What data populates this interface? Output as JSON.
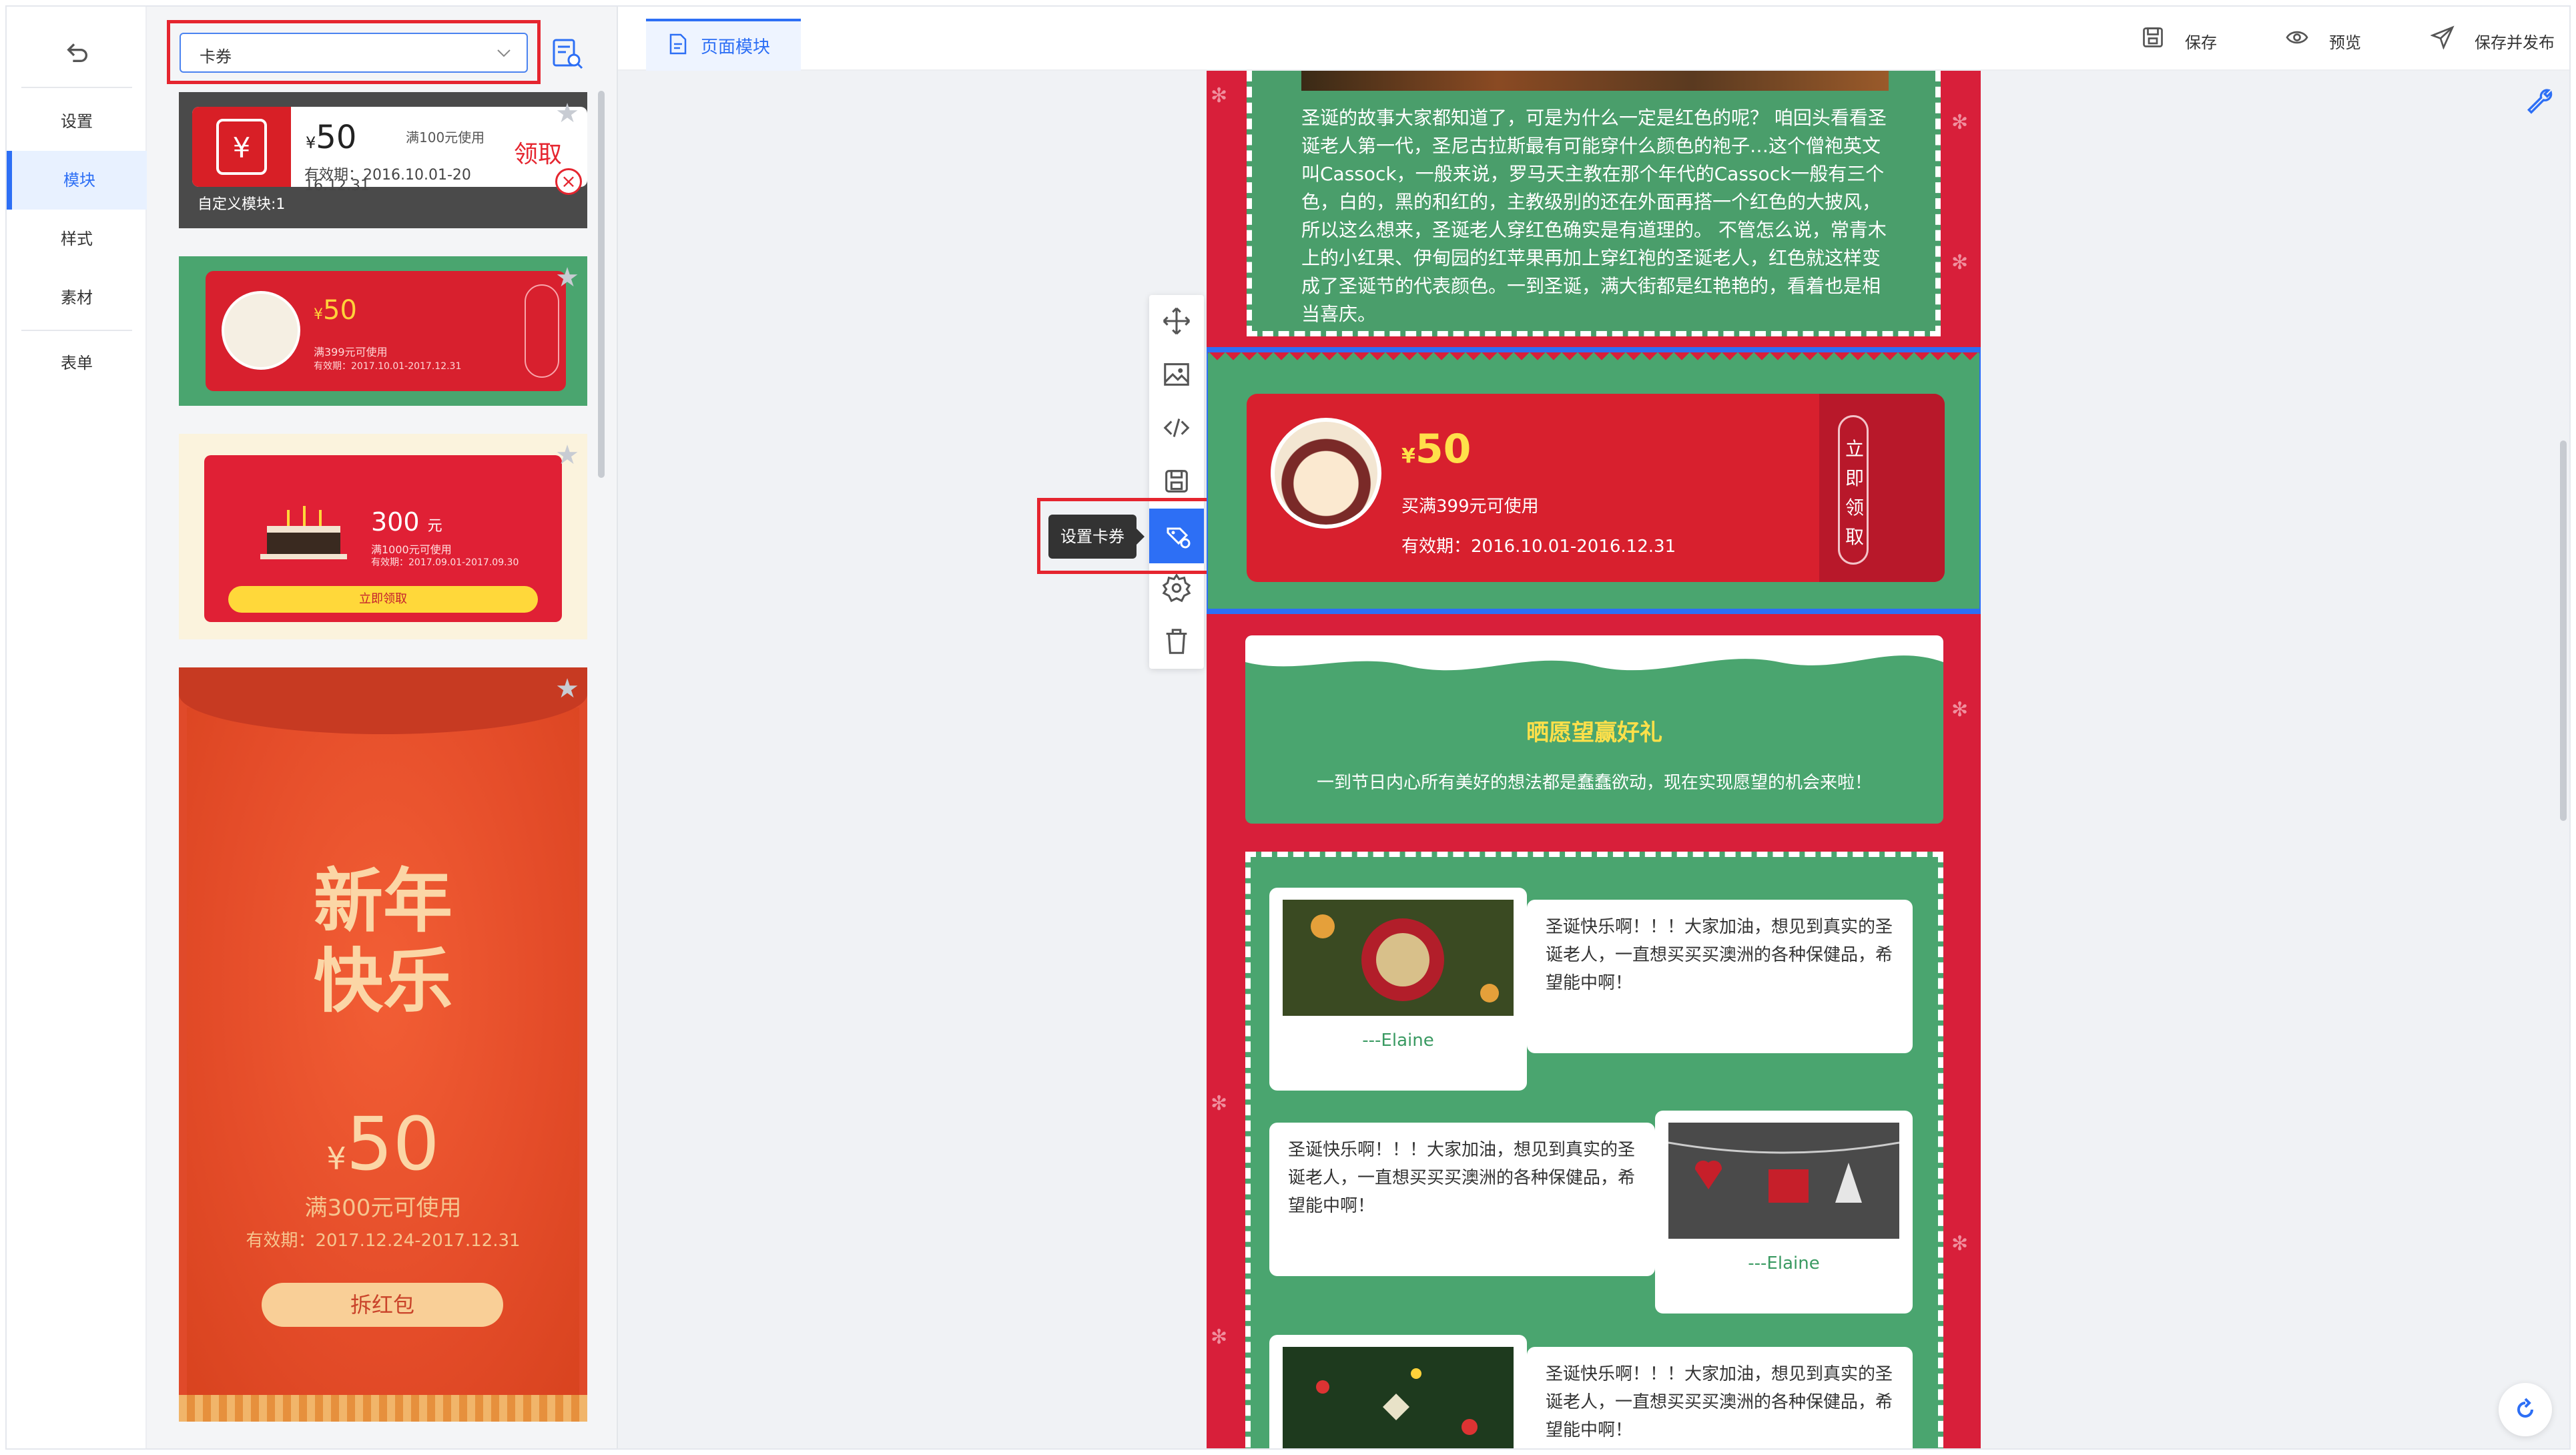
{
  "nav": {
    "items": [
      {
        "label": "设置",
        "active": false
      },
      {
        "label": "模块",
        "active": true
      },
      {
        "label": "样式",
        "active": false
      },
      {
        "label": "素材",
        "active": false
      },
      {
        "label": "表单",
        "active": false
      }
    ]
  },
  "panel": {
    "category_select": {
      "value": "卡券"
    },
    "templates": {
      "t1": {
        "amount": "50",
        "currency": "¥",
        "min": "满100元使用",
        "valid_line1": "有效期：2016.10.01-20",
        "valid_line2": "16.12.31",
        "get": "领取",
        "label": "自定义模块:1"
      },
      "t2": {
        "amount": "50",
        "currency": "¥",
        "min": "满399元可使用",
        "valid": "有效期：2017.10.01-2017.12.31"
      },
      "t3": {
        "amount": "300",
        "unit": "元",
        "min": "满1000元可使用",
        "valid": "有效期：2017.09.01-2017.09.30",
        "button": "立即领取"
      },
      "t4": {
        "title_line1": "新年",
        "title_line2": "快乐",
        "amount": "50",
        "currency": "¥",
        "min": "满300元可使用",
        "valid": "有效期：2017.12.24-2017.12.31",
        "button": "拆红包"
      }
    }
  },
  "topbar": {
    "tab_label": "页面模块",
    "save": "保存",
    "preview": "预览",
    "save_publish": "保存并发布"
  },
  "canvas": {
    "story_text": "圣诞的故事大家都知道了，可是为什么一定是红色的呢？ 咱回头看看圣诞老人第一代，圣尼古拉斯最有可能穿什么颜色的袍子…这个僧袍英文叫Cassock，一般来说，罗马天主教在那个年代的Cassock一般有三个色，白的，黑的和红的，主教级别的还在外面再搭一个红色的大披风，所以这么想来，圣诞老人穿红色确实是有道理的。 不管怎么说，常青木上的小红果、伊甸园的红苹果再加上穿红袍的圣诞老人，红色就这样变成了圣诞节的代表颜色。一到圣诞，满大街都是红艳艳的，看着也是相当喜庆。",
    "coupon": {
      "currency": "¥",
      "amount": "50",
      "min": "买满399元可使用",
      "valid": "有效期：2016.10.01-2016.12.31",
      "claim_v": [
        "立",
        "即",
        "领",
        "取"
      ]
    },
    "wish": {
      "title": "晒愿望赢好礼",
      "desc": "一到节日内心所有美好的想法都是蠢蠢欲动，现在实现愿望的机会来啦！"
    },
    "reviews": [
      {
        "text": "圣诞快乐啊！！！大家加油，想见到真实的圣诞老人，一直想买买买澳洲的各种保健品，希望能中啊！",
        "name": "---Elaine"
      },
      {
        "text": "圣诞快乐啊！！！大家加油，想见到真实的圣诞老人，一直想买买买澳洲的各种保健品，希望能中啊！",
        "name": "---Elaine"
      },
      {
        "text": "圣诞快乐啊！！！大家加油，想见到真实的圣诞老人，一直想买买买澳洲的各种保健品，希望能中啊！",
        "name": ""
      }
    ]
  },
  "float_toolbar": {
    "tooltip": "设置卡券"
  },
  "colors": {
    "accent": "#2d6ff5",
    "highlight": "#e5252f",
    "xmas_red": "#d81f3a",
    "xmas_green": "#4aa56f"
  }
}
